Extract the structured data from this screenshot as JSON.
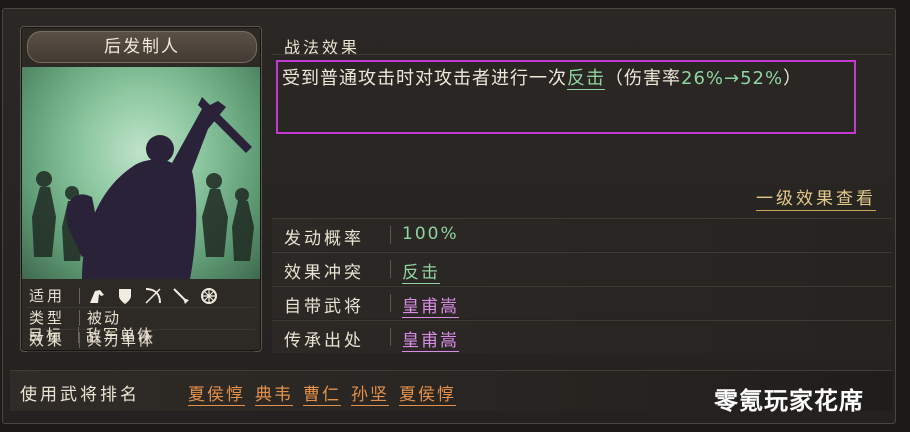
{
  "card": {
    "title": "后发制人",
    "stats": [
      {
        "key": "适用",
        "value": ""
      },
      {
        "key": "类型",
        "value": "被动"
      },
      {
        "key": "效果",
        "value": "兵刃单体"
      },
      {
        "key": "目标",
        "value": "敌军单体"
      }
    ],
    "applicable_icons": [
      "cavalry-icon",
      "shield-icon",
      "bow-icon",
      "spear-icon",
      "chariot-wheel-icon"
    ]
  },
  "effect": {
    "section_title": "战法效果",
    "desc_prefix": "受到普通攻击时对攻击者进行一次",
    "desc_keyword": "反击",
    "desc_mid": "（伤害率",
    "desc_from": "26%",
    "desc_arrow": "→",
    "desc_to": "52%",
    "desc_suffix": "）",
    "level_link": "一级效果查看"
  },
  "attributes": [
    {
      "key": "发动概率",
      "value": "100%"
    },
    {
      "key": "效果冲突",
      "value": "反击"
    },
    {
      "key": "自带武将",
      "value": "皇甫嵩"
    },
    {
      "key": "传承出处",
      "value": "皇甫嵩"
    }
  ],
  "ranking": {
    "label": "使用武将排名",
    "generals": [
      "夏侯惇",
      "典韦",
      "曹仁",
      "孙坚",
      "夏侯惇"
    ]
  },
  "watermark": "零氪玩家花席",
  "colors": {
    "highlight_box": "#c23ad0",
    "keyword_green": "#8fd4a0",
    "general_pink": "#d98ce6",
    "rank_orange": "#e4904a",
    "link_gold": "#e2c98a"
  }
}
